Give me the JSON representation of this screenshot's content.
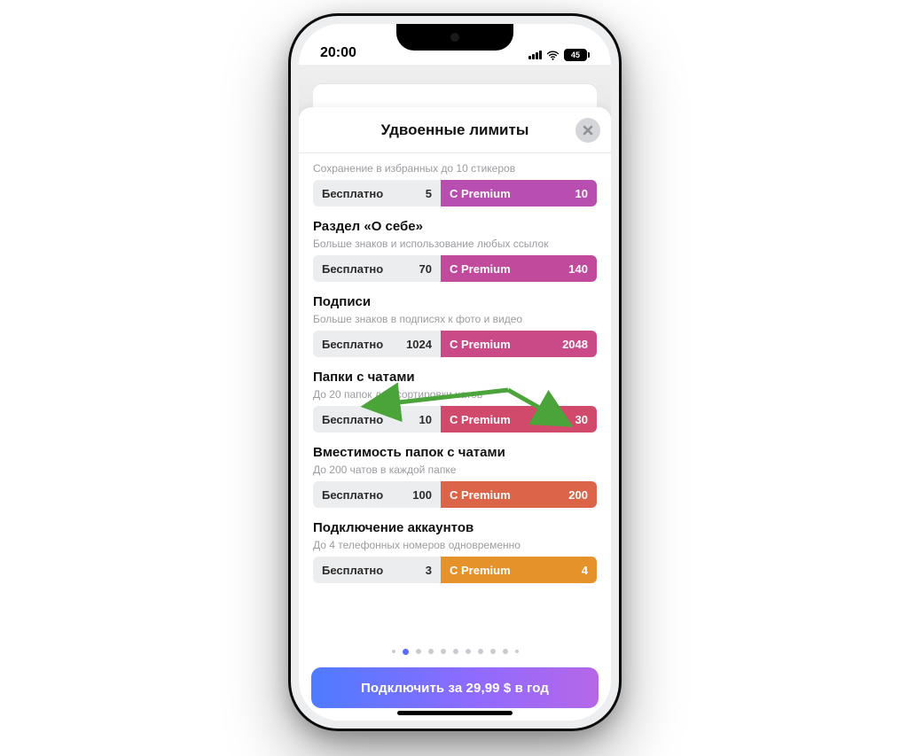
{
  "statusbar": {
    "time": "20:00",
    "battery": "45"
  },
  "sheet": {
    "title": "Удвоенные лимиты",
    "first_sub": "Сохранение в избранных до 10 стикеров",
    "free_label": "Бесплатно",
    "prem_label": "C Premium",
    "rows": [
      {
        "title": "",
        "sub": "Сохранение в избранных до 10 стикеров",
        "free": "5",
        "prem": "10",
        "color": "#b84fb0"
      },
      {
        "title": "Раздел «О себе»",
        "sub": "Больше знаков и использование любых ссылок",
        "free": "70",
        "prem": "140",
        "color": "#c24a9c"
      },
      {
        "title": "Подписи",
        "sub": "Больше знаков в подписях к фото и видео",
        "free": "1024",
        "prem": "2048",
        "color": "#c94a86"
      },
      {
        "title": "Папки с чатами",
        "sub": "До 20 папок для сортировки чатов",
        "free": "10",
        "prem": "30",
        "color": "#d14a6b"
      },
      {
        "title": "Вместимость папок с чатами",
        "sub": "До 200 чатов в каждой папке",
        "free": "100",
        "prem": "200",
        "color": "#dc6449"
      },
      {
        "title": "Подключение аккаунтов",
        "sub": "До 4 телефонных номеров одновременно",
        "free": "3",
        "prem": "4",
        "color": "#e6922a"
      }
    ],
    "pager": {
      "count": 11,
      "active": 1
    },
    "cta": "Подключить за 29,99 $ в год"
  },
  "annotation": {
    "color": "#4aa43a"
  }
}
